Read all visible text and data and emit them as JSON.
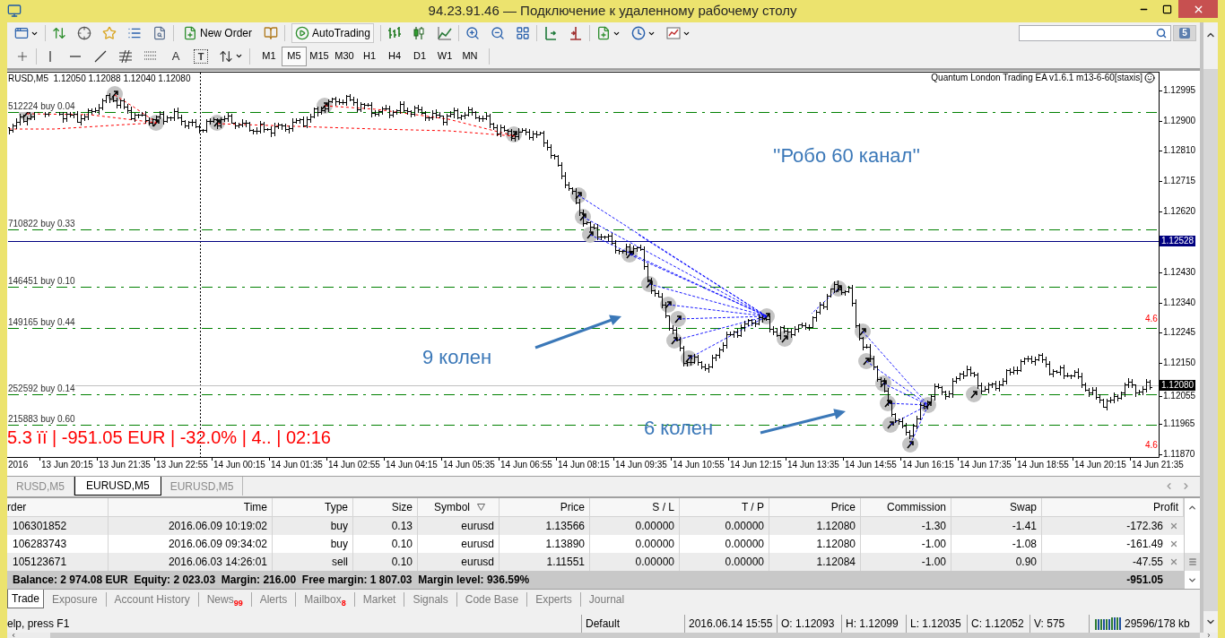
{
  "window": {
    "title": "94.23.91.46 — Подключение к удаленному рабочему столу"
  },
  "toolbar": {
    "new_order": "New Order",
    "auto_trading": "AutoTrading",
    "messages_count": "5"
  },
  "drawing_tools": [
    {
      "kind": "text",
      "label": "A"
    },
    {
      "kind": "label",
      "label": "T"
    }
  ],
  "periods": [
    {
      "label": "M1",
      "selected": false
    },
    {
      "label": "M5",
      "selected": true
    },
    {
      "label": "M15",
      "selected": false
    },
    {
      "label": "M30",
      "selected": false
    },
    {
      "label": "H1",
      "selected": false
    },
    {
      "label": "H4",
      "selected": false
    },
    {
      "label": "D1",
      "selected": false
    },
    {
      "label": "W1",
      "selected": false
    },
    {
      "label": "MN",
      "selected": false
    }
  ],
  "chart": {
    "info": "RUSD,M5  1.12050 1.12088 1.12040 1.12080",
    "expert": "Quantum London Trading EA v1.6.1 m13-6-60[staxis]",
    "order_lines": [
      "512224 buy 0.04",
      "710822 buy 0.33",
      "146451 buy 0.10",
      "149165 buy 0.44",
      "252592 buy 0.14",
      "215883 buy 0.60"
    ],
    "price_axis": [
      "1.12995",
      "1.12900",
      "1.12810",
      "1.12715",
      "1.12620",
      "1.12430",
      "1.12340",
      "1.12245",
      "1.12150",
      "1.12055",
      "1.11965",
      "1.11870"
    ],
    "price_markers": [
      {
        "label": "1.12528",
        "kind": "line"
      },
      {
        "label": "1.12080",
        "kind": "bid"
      }
    ],
    "edge_marks": [
      "4.6",
      "4.6"
    ],
    "status_text": "5.3 ïï | -951.05 EUR | -32.0% | 4.. | 02:16",
    "annotations": [
      {
        "text": "''Робо 60 канал''",
        "kind": "caption"
      },
      {
        "text": "9 колен",
        "kind": "callout"
      },
      {
        "text": "6 колен",
        "kind": "callout"
      }
    ],
    "time_axis": [
      "2016",
      "13 Jun 20:15",
      "13 Jun 21:35",
      "13 Jun 22:55",
      "14 Jun 00:15",
      "14 Jun 01:35",
      "14 Jun 02:55",
      "14 Jun 04:15",
      "14 Jun 05:35",
      "14 Jun 06:55",
      "14 Jun 08:15",
      "14 Jun 09:35",
      "14 Jun 10:55",
      "14 Jun 12:15",
      "14 Jun 13:35",
      "14 Jun 14:55",
      "14 Jun 16:15",
      "14 Jun 17:35",
      "14 Jun 18:55",
      "14 Jun 20:15",
      "14 Jun 21:35"
    ]
  },
  "chart_tabs": [
    {
      "label": "RUSD,M5",
      "selected": false
    },
    {
      "label": "EURUSD,M5",
      "selected": true
    },
    {
      "label": "EURUSD,M5",
      "selected": false
    }
  ],
  "trade_table": {
    "columns": [
      {
        "label": "rder",
        "sorted": false
      },
      {
        "label": "Time",
        "sorted": false
      },
      {
        "label": "Type",
        "sorted": false
      },
      {
        "label": "Size",
        "sorted": false
      },
      {
        "label": "Symbol",
        "sorted": true
      },
      {
        "label": "Price",
        "sorted": false
      },
      {
        "label": "S / L",
        "sorted": false
      },
      {
        "label": "T / P",
        "sorted": false
      },
      {
        "label": "Price",
        "sorted": false
      },
      {
        "label": "Commission",
        "sorted": false
      },
      {
        "label": "Swap",
        "sorted": false
      },
      {
        "label": "Profit",
        "sorted": false
      }
    ],
    "rows": [
      [
        "106301852",
        "2016.06.09 10:19:02",
        "buy",
        "0.13",
        "eurusd",
        "1.13566",
        "0.00000",
        "0.00000",
        "1.12080",
        "-1.30",
        "-1.41",
        "-172.36"
      ],
      [
        "106283743",
        "2016.06.09 09:34:02",
        "buy",
        "0.10",
        "eurusd",
        "1.13890",
        "0.00000",
        "0.00000",
        "1.12080",
        "-1.00",
        "-1.08",
        "-161.49"
      ],
      [
        "105123671",
        "2016.06.03 14:26:01",
        "sell",
        "0.10",
        "eurusd",
        "1.11551",
        "0.00000",
        "0.00000",
        "1.12084",
        "-1.00",
        "0.90",
        "-47.55"
      ]
    ],
    "summary": "Balance: 2 974.08 EUR  Equity: 2 023.03  Margin: 216.00  Free margin: 1 807.03  Margin level: 936.59%",
    "total_profit": "-951.05"
  },
  "terminal_tabs": [
    {
      "label": "Trade",
      "selected": true
    },
    {
      "label": "Exposure",
      "selected": false
    },
    {
      "label": "Account History",
      "selected": false
    },
    {
      "label": "News",
      "badge": "99",
      "selected": false
    },
    {
      "label": "Alerts",
      "selected": false
    },
    {
      "label": "Mailbox",
      "badge": "8",
      "selected": false
    },
    {
      "label": "Market",
      "selected": false
    },
    {
      "label": "Signals",
      "selected": false
    },
    {
      "label": "Code Base",
      "selected": false
    },
    {
      "label": "Experts",
      "selected": false
    },
    {
      "label": "Journal",
      "selected": false
    }
  ],
  "status_bar": {
    "help": "elp, press F1",
    "profile": "Default",
    "fields": [
      "2016.06.14 15:55",
      "O: 1.12093",
      "H: 1.12099",
      "L: 1.12035",
      "C: 1.12052",
      "V: 575"
    ],
    "traffic": "29596/178 kb"
  }
}
